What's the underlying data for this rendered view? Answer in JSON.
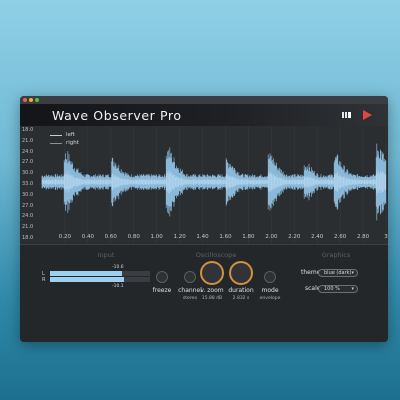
{
  "window": {
    "title": "Wave Observer Pro"
  },
  "waveform": {
    "y_ticks": [
      "18.0",
      "21.0",
      "24.0",
      "27.0",
      "30.0",
      "33.0",
      "30.0",
      "27.0",
      "24.0",
      "21.0",
      "18.0"
    ],
    "x_ticks": [
      "0.20",
      "0.40",
      "0.60",
      "0.80",
      "1.00",
      "1.20",
      "1.40",
      "1.60",
      "1.80",
      "2.00",
      "2.20",
      "2.40",
      "2.60",
      "2.80",
      "3"
    ],
    "legend": [
      {
        "label": "left",
        "color": "#c9cdd1"
      },
      {
        "label": "right",
        "color": "#8a8f94"
      }
    ],
    "colors": {
      "wave": "#8ab8d8",
      "wave_light": "#b3d6ee",
      "grid": "#3a3e42"
    }
  },
  "panel": {
    "input": {
      "title": "Input",
      "channels": [
        {
          "label": "L",
          "value": "-10.6",
          "level": 0.72
        },
        {
          "label": "R",
          "value": "-10.1",
          "level": 0.74
        }
      ]
    },
    "oscilloscope": {
      "title": "Oscilloscope",
      "controls": [
        {
          "label": "freeze",
          "sub": "",
          "type": "small"
        },
        {
          "label": "channel",
          "sub": "stereo",
          "type": "small"
        },
        {
          "label": "v. zoom",
          "sub": "15.88 dB",
          "type": "big"
        },
        {
          "label": "duration",
          "sub": "2.832 s",
          "type": "big"
        },
        {
          "label": "mode",
          "sub": "envelope",
          "type": "small"
        }
      ]
    },
    "graphics": {
      "title": "Graphics",
      "theme_label": "theme",
      "theme_value": "blue (dark)",
      "scale_label": "scale",
      "scale_value": "100 %"
    }
  }
}
